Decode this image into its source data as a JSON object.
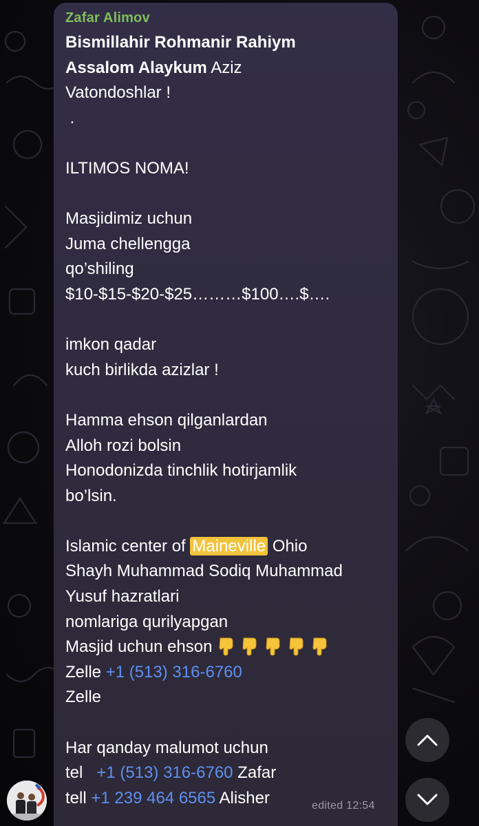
{
  "chat": {
    "sender_name": "Zafar Alimov",
    "sender_color": "#7fbf5a",
    "link_color": "#5e8fef",
    "highlight_color": "#f2c33c",
    "edited_label": "edited",
    "time": "12:54"
  },
  "message": {
    "greeting_1": "Bismillahir Rohmanir Rahiym",
    "greeting_2_bold": "Assalom Alaykum",
    "greeting_2_rest": " Aziz",
    "greeting_3": "Vatondoshlar !",
    "dot": " .",
    "request": "ILTIMOS NOMA!",
    "p1_l1": "Masjidimiz uchun",
    "p1_l2": "Juma chellengga",
    "p1_l3": "qo’shiling",
    "p1_l4": "$10-$15-$20-$25………$100….$….",
    "p2_l1": "imkon qadar",
    "p2_l2": "kuch birlikda azizlar !",
    "p3_l1": "Hamma ehson qilganlardan",
    "p3_l2": "Alloh rozi bolsin",
    "p3_l3": "Honodonizda tinchlik hotirjamlik",
    "p3_l4": "bo’lsin.",
    "p4_l1_pre": "Islamic center of ",
    "p4_l1_highlight": "Maineville",
    "p4_l1_post": " Ohio",
    "p4_l2": "Shayh Muhammad Sodiq Muhammad",
    "p4_l3": "Yusuf hazratlari",
    "p4_l4": "nomlariga qurilyapgan",
    "p4_l5": "Masjid uchun ehson",
    "p4_l5_emoji": "backhand-index-pointing-down x5",
    "zelle_label_1": "Zelle ",
    "zelle_phone": "+1 (513) 316-6760",
    "zelle_label_2": "Zelle",
    "info": "Har qanday malumot uchun",
    "tel_1_label": "tel   ",
    "tel_1_phone": "+1 (513) 316-6760",
    "tel_1_name": " Zafar",
    "tel_2_label": "tell ",
    "tel_2_phone": "+1 239 464 6565",
    "tel_2_name": " Alisher"
  },
  "controls": {
    "scroll_up_icon": "chevron-up-icon",
    "scroll_down_icon": "chevron-down-icon"
  }
}
